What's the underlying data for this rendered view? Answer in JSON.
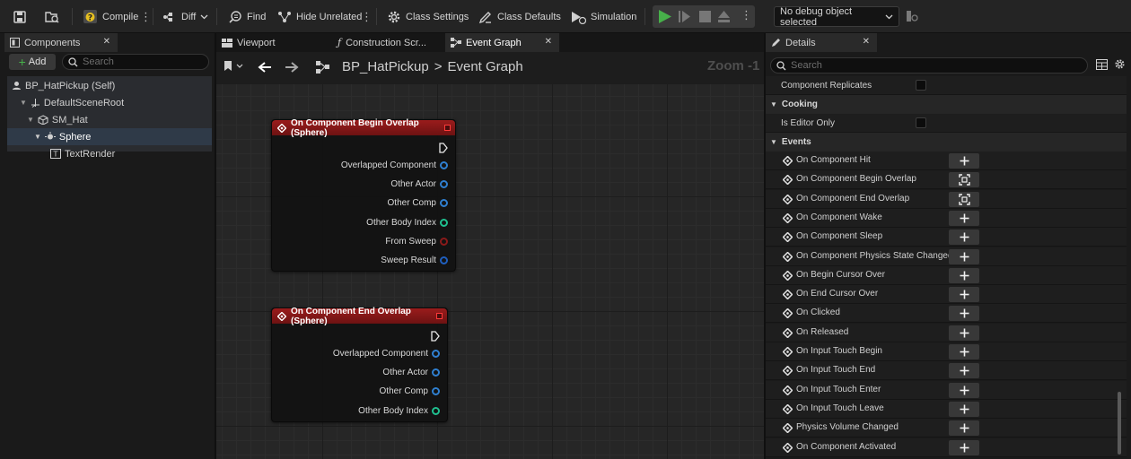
{
  "toolbar": {
    "compile_label": "Compile",
    "diff_label": "Diff",
    "find_label": "Find",
    "hide_unrelated_label": "Hide Unrelated",
    "class_settings_label": "Class Settings",
    "class_defaults_label": "Class Defaults",
    "simulation_label": "Simulation",
    "debug_object_label": "No debug object selected"
  },
  "left_panel": {
    "tab_label": "Components",
    "add_label": "Add",
    "search_placeholder": "Search",
    "tree": [
      {
        "label": "BP_HatPickup (Self)",
        "icon": "self-icon"
      },
      {
        "label": "DefaultSceneRoot",
        "icon": "scene-root-icon"
      },
      {
        "label": "SM_Hat",
        "icon": "static-mesh-icon"
      },
      {
        "label": "Sphere",
        "icon": "sphere-collision-icon"
      },
      {
        "label": "TextRender",
        "icon": "text-render-icon"
      }
    ]
  },
  "graph": {
    "tabs": [
      {
        "label": "Viewport",
        "icon": "viewport-icon"
      },
      {
        "label": "Construction Scr...",
        "icon": "function-icon"
      },
      {
        "label": "Event Graph",
        "icon": "event-graph-icon"
      }
    ],
    "breadcrumb_blueprint": "BP_HatPickup",
    "breadcrumb_separator": ">",
    "breadcrumb_graph": "Event Graph",
    "zoom_label": "Zoom -1",
    "nodes": [
      {
        "title": "On Component Begin Overlap (Sphere)",
        "pins": [
          {
            "label": "Overlapped Component",
            "color": "#2f7fd0"
          },
          {
            "label": "Other Actor",
            "color": "#2f7fd0"
          },
          {
            "label": "Other Comp",
            "color": "#2f7fd0"
          },
          {
            "label": "Other Body Index",
            "color": "#1fbf8f"
          },
          {
            "label": "From Sweep",
            "color": "#8a1a1a"
          },
          {
            "label": "Sweep Result",
            "color": "#1f5fbf"
          }
        ]
      },
      {
        "title": "On Component End Overlap (Sphere)",
        "pins": [
          {
            "label": "Overlapped Component",
            "color": "#2f7fd0"
          },
          {
            "label": "Other Actor",
            "color": "#2f7fd0"
          },
          {
            "label": "Other Comp",
            "color": "#2f7fd0"
          },
          {
            "label": "Other Body Index",
            "color": "#1fbf8f"
          }
        ]
      }
    ]
  },
  "details": {
    "tab_label": "Details",
    "search_placeholder": "Search",
    "component_replicates_label": "Component Replicates",
    "cooking_label": "Cooking",
    "is_editor_only_label": "Is Editor Only",
    "events_label": "Events",
    "events": [
      {
        "label": "On Component Hit",
        "bound": false
      },
      {
        "label": "On Component Begin Overlap",
        "bound": true
      },
      {
        "label": "On Component End Overlap",
        "bound": true
      },
      {
        "label": "On Component Wake",
        "bound": false
      },
      {
        "label": "On Component Sleep",
        "bound": false
      },
      {
        "label": "On Component Physics State Changed",
        "bound": false
      },
      {
        "label": "On Begin Cursor Over",
        "bound": false
      },
      {
        "label": "On End Cursor Over",
        "bound": false
      },
      {
        "label": "On Clicked",
        "bound": false
      },
      {
        "label": "On Released",
        "bound": false
      },
      {
        "label": "On Input Touch Begin",
        "bound": false
      },
      {
        "label": "On Input Touch End",
        "bound": false
      },
      {
        "label": "On Input Touch Enter",
        "bound": false
      },
      {
        "label": "On Input Touch Leave",
        "bound": false
      },
      {
        "label": "Physics Volume Changed",
        "bound": false
      },
      {
        "label": "On Component Activated",
        "bound": false
      }
    ]
  },
  "colors": {
    "accent_green": "#47b04a",
    "node_header_red": "#8a1818",
    "selection_blue": "#2f3a48"
  }
}
